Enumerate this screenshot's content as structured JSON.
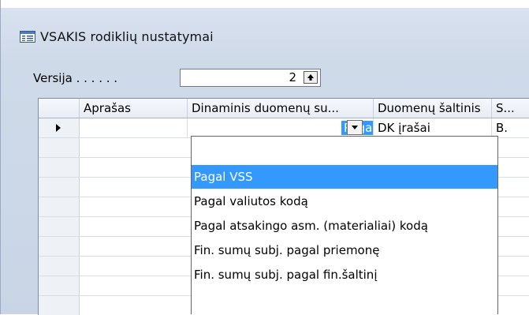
{
  "window": {
    "title": "VSAKIS rodiklių nustatymai",
    "icon": "form-icon"
  },
  "version_field": {
    "label": "Versija . . . . . .",
    "value": "2",
    "stepper_icon": "arrow-up-icon"
  },
  "table": {
    "columns": [
      "Aprašas",
      "Dinaminis duomenų su...",
      "Duomenų šaltinis",
      "S..."
    ],
    "rows": [
      {
        "current": true,
        "aprasas": "",
        "dinaminis": "Pagal VSS",
        "saltinis": "DK įrašai",
        "s": "B."
      }
    ]
  },
  "dropdown": {
    "options": [
      "",
      "Pagal VSS",
      "Pagal valiutos kodą",
      "Pagal atsakingo asm. (materialiai) kodą",
      "Fin. sumų subj. pagal priemonę",
      "Fin. sumų subj. pagal fin.šaltinį"
    ],
    "selected_index": 1
  },
  "colors": {
    "selection": "#3399ff",
    "window_bg": "#d5dfed"
  }
}
